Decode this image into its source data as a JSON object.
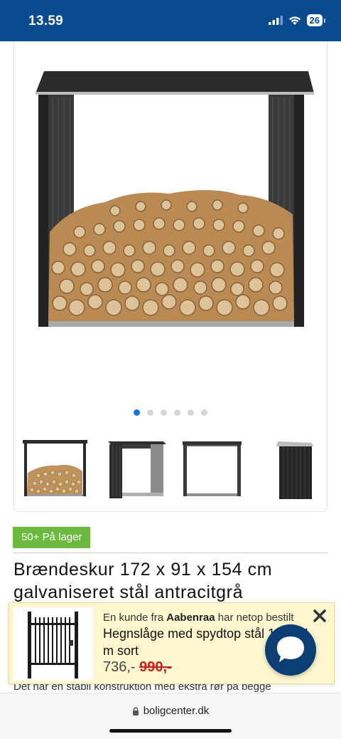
{
  "status_bar": {
    "time": "13.59",
    "battery": "26",
    "icons": [
      "signal-icon",
      "wifi-icon",
      "battery-icon"
    ]
  },
  "gallery": {
    "main_image": "firewood-shed-with-logs",
    "dots_count": 6,
    "active_dot": 0,
    "thumbnails": [
      "shed-with-firewood",
      "shed-angled-view",
      "shed-front-view",
      "shed-side-view"
    ]
  },
  "product": {
    "stock_badge": "50+ På lager",
    "title": "Brændeskur 172 x 91 x 154 cm galvaniseret stål antracitgrå",
    "description_partial": "Det har en stabil konstruktion med ekstra rør på begge"
  },
  "notification": {
    "prefix": "En kunde fra ",
    "city": "Aabenraa",
    "suffix": " har netop bestilt",
    "product_title": "Hegnslåge med spydtop stål 100 x 1 m sort",
    "price": "736,-",
    "old_price": "990,-",
    "image": "black-metal-gate"
  },
  "browser": {
    "url": "boligcenter.dk"
  },
  "colors": {
    "header_blue": "#0a4a8f",
    "badge_green": "#6cb93f",
    "active_dot": "#1a73d9",
    "old_price_red": "#c81e1e",
    "notification_bg": "#fdf6cf",
    "chat_blue": "#0b3f74"
  }
}
